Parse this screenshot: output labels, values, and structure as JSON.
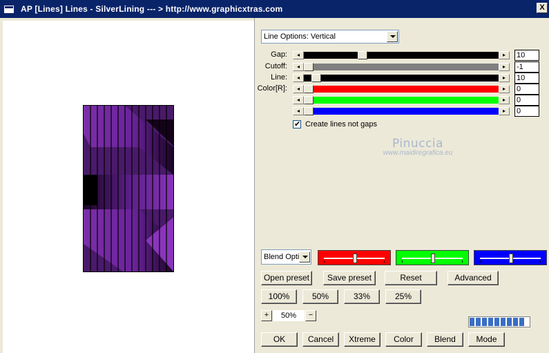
{
  "window": {
    "title": "AP [Lines]  Lines - SilverLining     --- > http://www.graphicxtras.com",
    "close_label": "X"
  },
  "line_options": {
    "value": "Line Options: Vertical"
  },
  "params": [
    {
      "label": "Gap:",
      "value": "10",
      "level": 0.29,
      "track_color": "#000000"
    },
    {
      "label": "Cutoff:",
      "value": "-1",
      "level": 0.0,
      "track_color": "#808080"
    },
    {
      "label": "Line:",
      "value": "10",
      "level": 0.04,
      "track_color": "#000000"
    },
    {
      "label": "Color[R]:",
      "value": "0",
      "level": 0.0,
      "track_color": "#ff0000"
    },
    {
      "label": "",
      "value": "0",
      "level": 0.0,
      "track_color": "#00ff00"
    },
    {
      "label": "",
      "value": "0",
      "level": 0.0,
      "track_color": "#0000ff"
    }
  ],
  "checkbox": {
    "label": "Create lines not gaps",
    "checked": true
  },
  "watermark": {
    "line1": "Pinuccia",
    "line2": "www.maidiregrafica.eu"
  },
  "blend": {
    "value": "Blend Optio"
  },
  "blend_colors": [
    {
      "color": "#ff0000",
      "level": 0.5
    },
    {
      "color": "#00ff00",
      "level": 0.5
    },
    {
      "color": "#0000ff",
      "level": 0.5
    }
  ],
  "buttons_row1": [
    "Open preset",
    "Save preset",
    "Reset",
    "Advanced"
  ],
  "buttons_row2": [
    "100%",
    "50%",
    "33%",
    "25%"
  ],
  "zoom": {
    "minus": "−",
    "value": "50%",
    "plus": "+"
  },
  "progress": {
    "segments": 9
  },
  "buttons_bottom": [
    "OK",
    "Cancel",
    "Xtreme",
    "Color",
    "Blend",
    "Mode"
  ],
  "scroll_arrows": {
    "left": "◂",
    "right": "▸"
  }
}
